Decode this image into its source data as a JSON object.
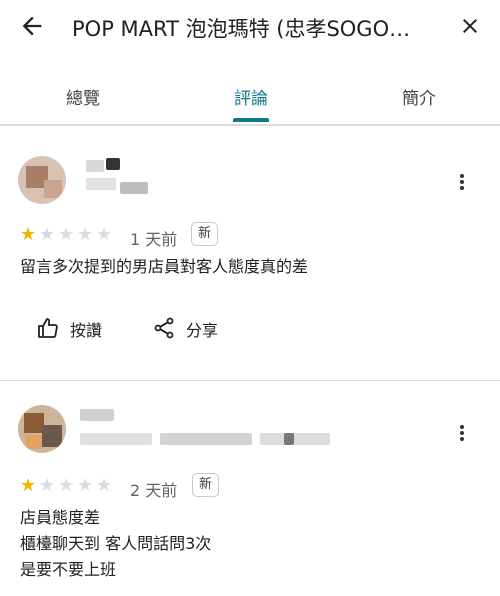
{
  "header": {
    "title": "POP MART 泡泡瑪特 (忠孝SOGO…"
  },
  "tabs": [
    "總覽",
    "評論",
    "簡介"
  ],
  "reviews": [
    {
      "rating": 1,
      "age": "1 天前",
      "badge": "新",
      "lines": [
        "留言多次提到的男店員對客人態度真的差"
      ],
      "like_label": "按讚",
      "share_label": "分享"
    },
    {
      "rating": 1,
      "age": "2 天前",
      "badge": "新",
      "lines": [
        "店員態度差",
        "櫃檯聊天到 客人問話問3次",
        "是要不要上班"
      ]
    }
  ],
  "colors": {
    "accent": "#0b7d8a",
    "star": "#f6b400"
  }
}
